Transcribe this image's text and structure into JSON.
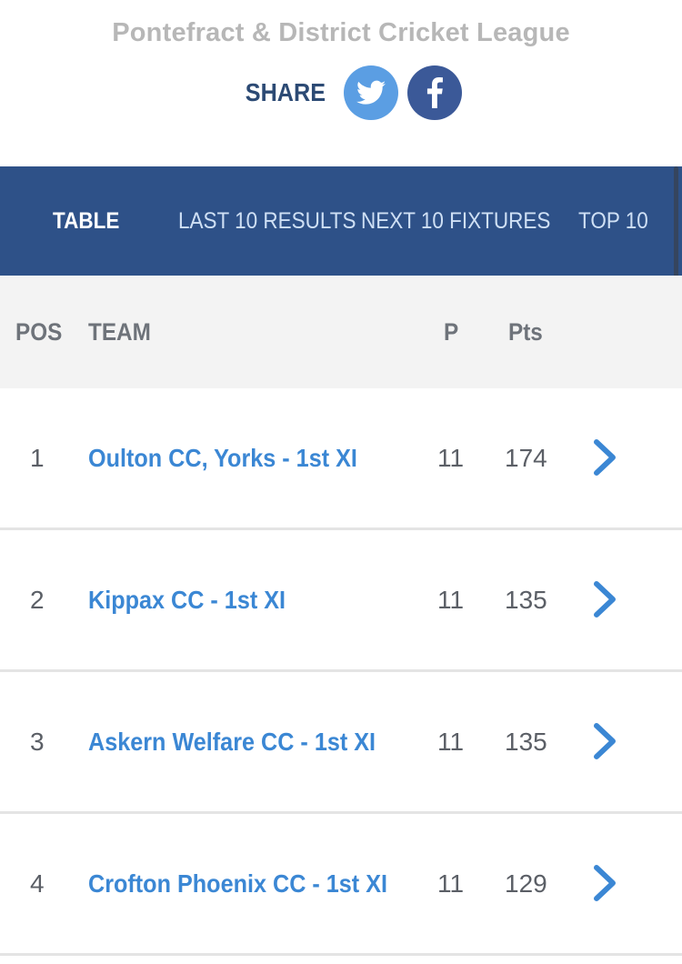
{
  "header": {
    "league_title": "Pontefract & District Cricket League",
    "share_label": "SHARE",
    "social": [
      {
        "name": "twitter",
        "icon": "twitter-bird-icon",
        "color": "#5b9ee3"
      },
      {
        "name": "facebook",
        "icon": "facebook-f-icon",
        "color": "#3b5998"
      }
    ]
  },
  "nav": {
    "tabs": [
      {
        "label": "TABLE",
        "active": true
      },
      {
        "label": "LAST 10 RESULTS",
        "active": false
      },
      {
        "label": "NEXT 10 FIXTURES",
        "active": false
      },
      {
        "label": "TOP 10",
        "active": false
      }
    ],
    "color": "#2e5188"
  },
  "table": {
    "columns": {
      "pos": "POS",
      "team": "TEAM",
      "played": "P",
      "points": "Pts"
    },
    "rows": [
      {
        "pos": "1",
        "team": "Oulton CC, Yorks - 1st XI",
        "played": "11",
        "points": "174"
      },
      {
        "pos": "2",
        "team": "Kippax CC - 1st XI",
        "played": "11",
        "points": "135"
      },
      {
        "pos": "3",
        "team": "Askern Welfare CC - 1st XI",
        "played": "11",
        "points": "135"
      },
      {
        "pos": "4",
        "team": "Crofton Phoenix CC - 1st XI",
        "played": "11",
        "points": "129"
      }
    ],
    "row_link_icon": "chevron-right-icon",
    "accent": "#3b87d4"
  }
}
